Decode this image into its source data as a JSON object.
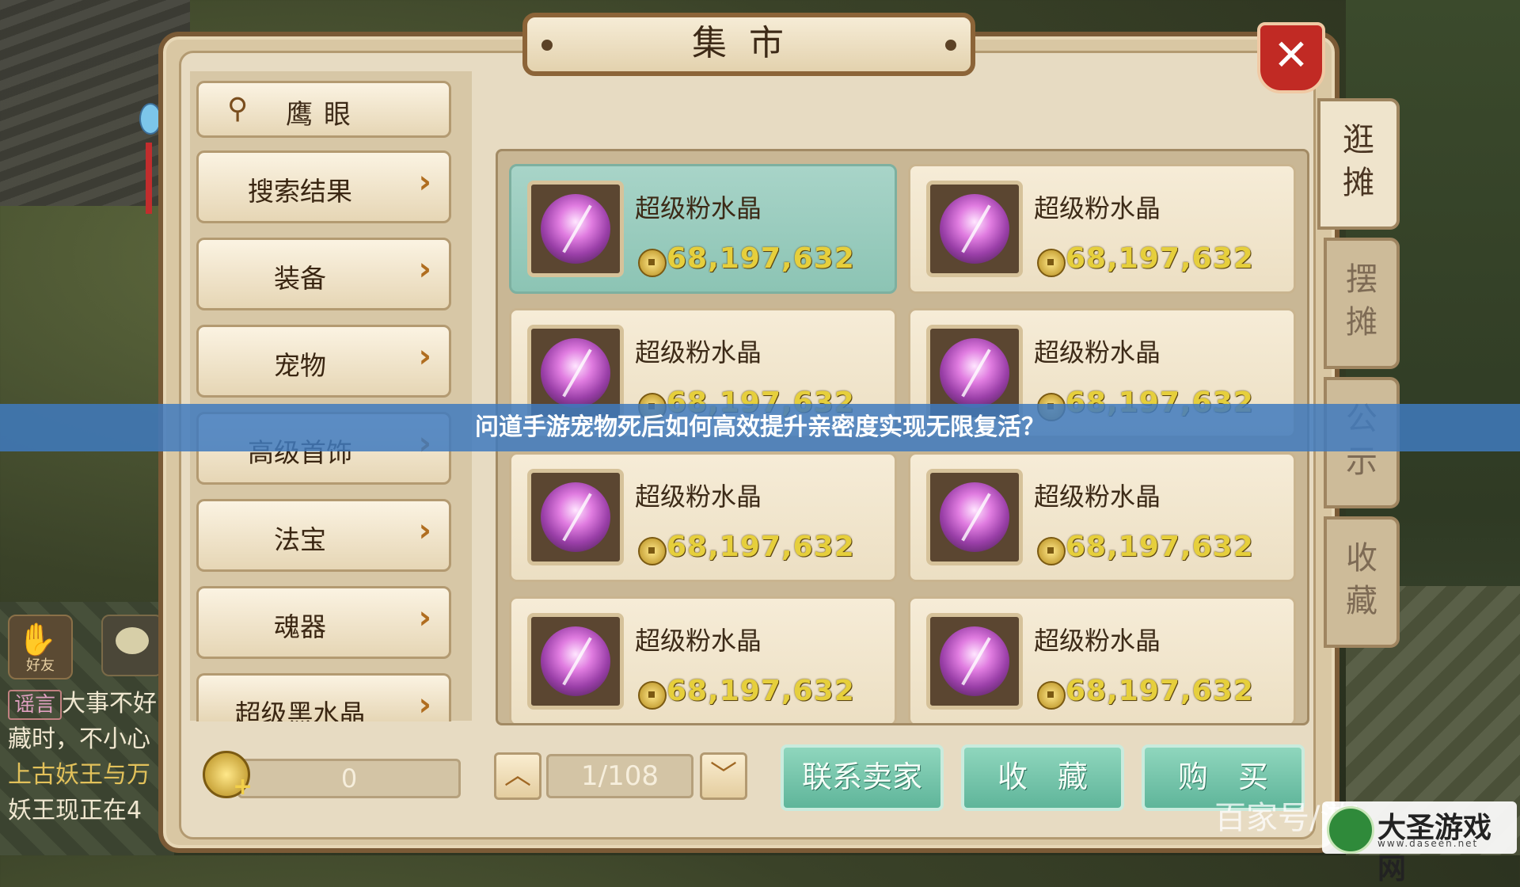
{
  "market": {
    "title": "集市",
    "close_label": "✕",
    "search_label": "鹰眼",
    "categories": [
      {
        "label": "搜索结果"
      },
      {
        "label": "装备"
      },
      {
        "label": "宠物"
      },
      {
        "label": "高级首饰"
      },
      {
        "label": "法宝"
      },
      {
        "label": "魂器"
      },
      {
        "label": "超级黑水晶"
      }
    ],
    "category_arrow": "›",
    "side_tabs": [
      {
        "label_top": "逛",
        "label_bottom": "摊",
        "active": true
      },
      {
        "label_top": "摆",
        "label_bottom": "摊",
        "active": false
      },
      {
        "label_top": "公",
        "label_bottom": "示",
        "active": false
      },
      {
        "label_top": "收",
        "label_bottom": "藏",
        "active": false
      }
    ],
    "items": [
      {
        "name": "超级粉水晶",
        "price": "68,197,632",
        "selected": true
      },
      {
        "name": "超级粉水晶",
        "price": "68,197,632",
        "selected": false
      },
      {
        "name": "超级粉水晶",
        "price": "68,197,632",
        "selected": false
      },
      {
        "name": "超级粉水晶",
        "price": "68,197,632",
        "selected": false
      },
      {
        "name": "超级粉水晶",
        "price": "68,197,632",
        "selected": false
      },
      {
        "name": "超级粉水晶",
        "price": "68,197,632",
        "selected": false
      },
      {
        "name": "超级粉水晶",
        "price": "68,197,632",
        "selected": false
      },
      {
        "name": "超级粉水晶",
        "price": "68,197,632",
        "selected": false
      }
    ],
    "currency_value": "0",
    "currency_plus": "+",
    "page_up": "︿",
    "page_down": "﹀",
    "page_indicator": "1/108",
    "btn_contact": "联系卖家",
    "btn_favorite": "收　藏",
    "btn_buy": "购　买"
  },
  "hud": {
    "friend_label": "好友",
    "friend_icon": "handshake-icon",
    "chat_icon": "speech-bubble-icon",
    "chat_lines": [
      {
        "tag": "谣言",
        "text": "大事不好"
      },
      {
        "text": "藏时，不小心"
      },
      {
        "text": "上古妖王与万"
      },
      {
        "text": "妖王现正在4"
      }
    ]
  },
  "banner": {
    "text": "问道手游宠物死后如何高效提升亲密度实现无限复活？"
  },
  "watermark": {
    "text": "百家号/游戏攻略",
    "logo_name": "大圣游戏网",
    "logo_url": "www.daseen.net"
  },
  "colors": {
    "selected_card": "#8cc4b4",
    "price": "#e6cf3c",
    "close": "#c12a24",
    "action_button": "#5fb59a",
    "banner": "#407abe"
  }
}
